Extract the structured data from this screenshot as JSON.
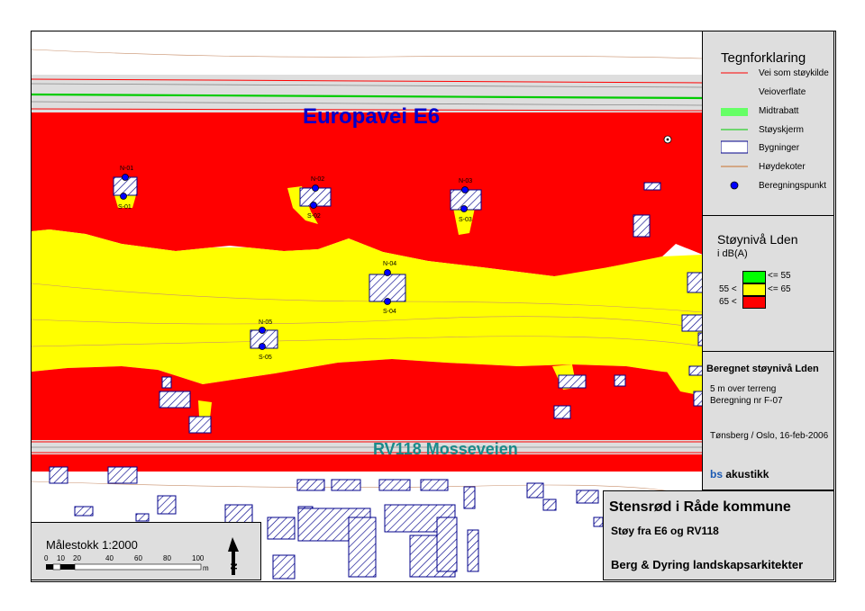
{
  "map": {
    "road_labels": {
      "e6": "Europavei E6",
      "rv118": "RV118 Mosseveien"
    },
    "points": [
      {
        "label": "N-01"
      },
      {
        "label": "S-01"
      },
      {
        "label": "N-02"
      },
      {
        "label": "S-02"
      },
      {
        "label": "N-03"
      },
      {
        "label": "S-03"
      },
      {
        "label": "N-04"
      },
      {
        "label": "S-04"
      },
      {
        "label": "N-05"
      },
      {
        "label": "S-05"
      }
    ]
  },
  "legend": {
    "title": "Tegnforklaring",
    "items": [
      {
        "label": "Vei som støykilde",
        "icon": "red-line"
      },
      {
        "label": "Veioverflate",
        "icon": "none"
      },
      {
        "label": "Midtrabatt",
        "icon": "green-fill"
      },
      {
        "label": "Støyskjerm",
        "icon": "green-line"
      },
      {
        "label": "Bygninger",
        "icon": "hatched-box"
      },
      {
        "label": "Høydekoter",
        "icon": "brown-line"
      },
      {
        "label": "Beregningspunkt",
        "icon": "blue-dot"
      }
    ]
  },
  "noise_levels": {
    "title": "Støynivå Lden",
    "unit": "i dB(A)",
    "row1_right": "<= 55",
    "row2_left": "55 <",
    "row2_right": "<= 65",
    "row3_left": "65 <",
    "colors": {
      "green": "#00ff00",
      "yellow": "#ffff00",
      "red": "#ff0000"
    }
  },
  "info": {
    "heading": "Beregnet støynivå Lden",
    "line1": "5 m over terreng",
    "line2": "Beregning nr F-07",
    "place_date": "Tønsberg / Oslo, 16-feb-2006",
    "company_prefix": "bs",
    "company_suffix": " akustikk"
  },
  "title_block": {
    "title": "Stensrød i Råde kommune",
    "subtitle": "Støy fra E6 og RV118",
    "author": "Berg & Dyring landskapsarkitekter"
  },
  "scale": {
    "label": "Målestokk 1:2000",
    "ticks": [
      "0",
      "10",
      "20",
      "40",
      "60",
      "80",
      "100"
    ],
    "unit": "m"
  }
}
